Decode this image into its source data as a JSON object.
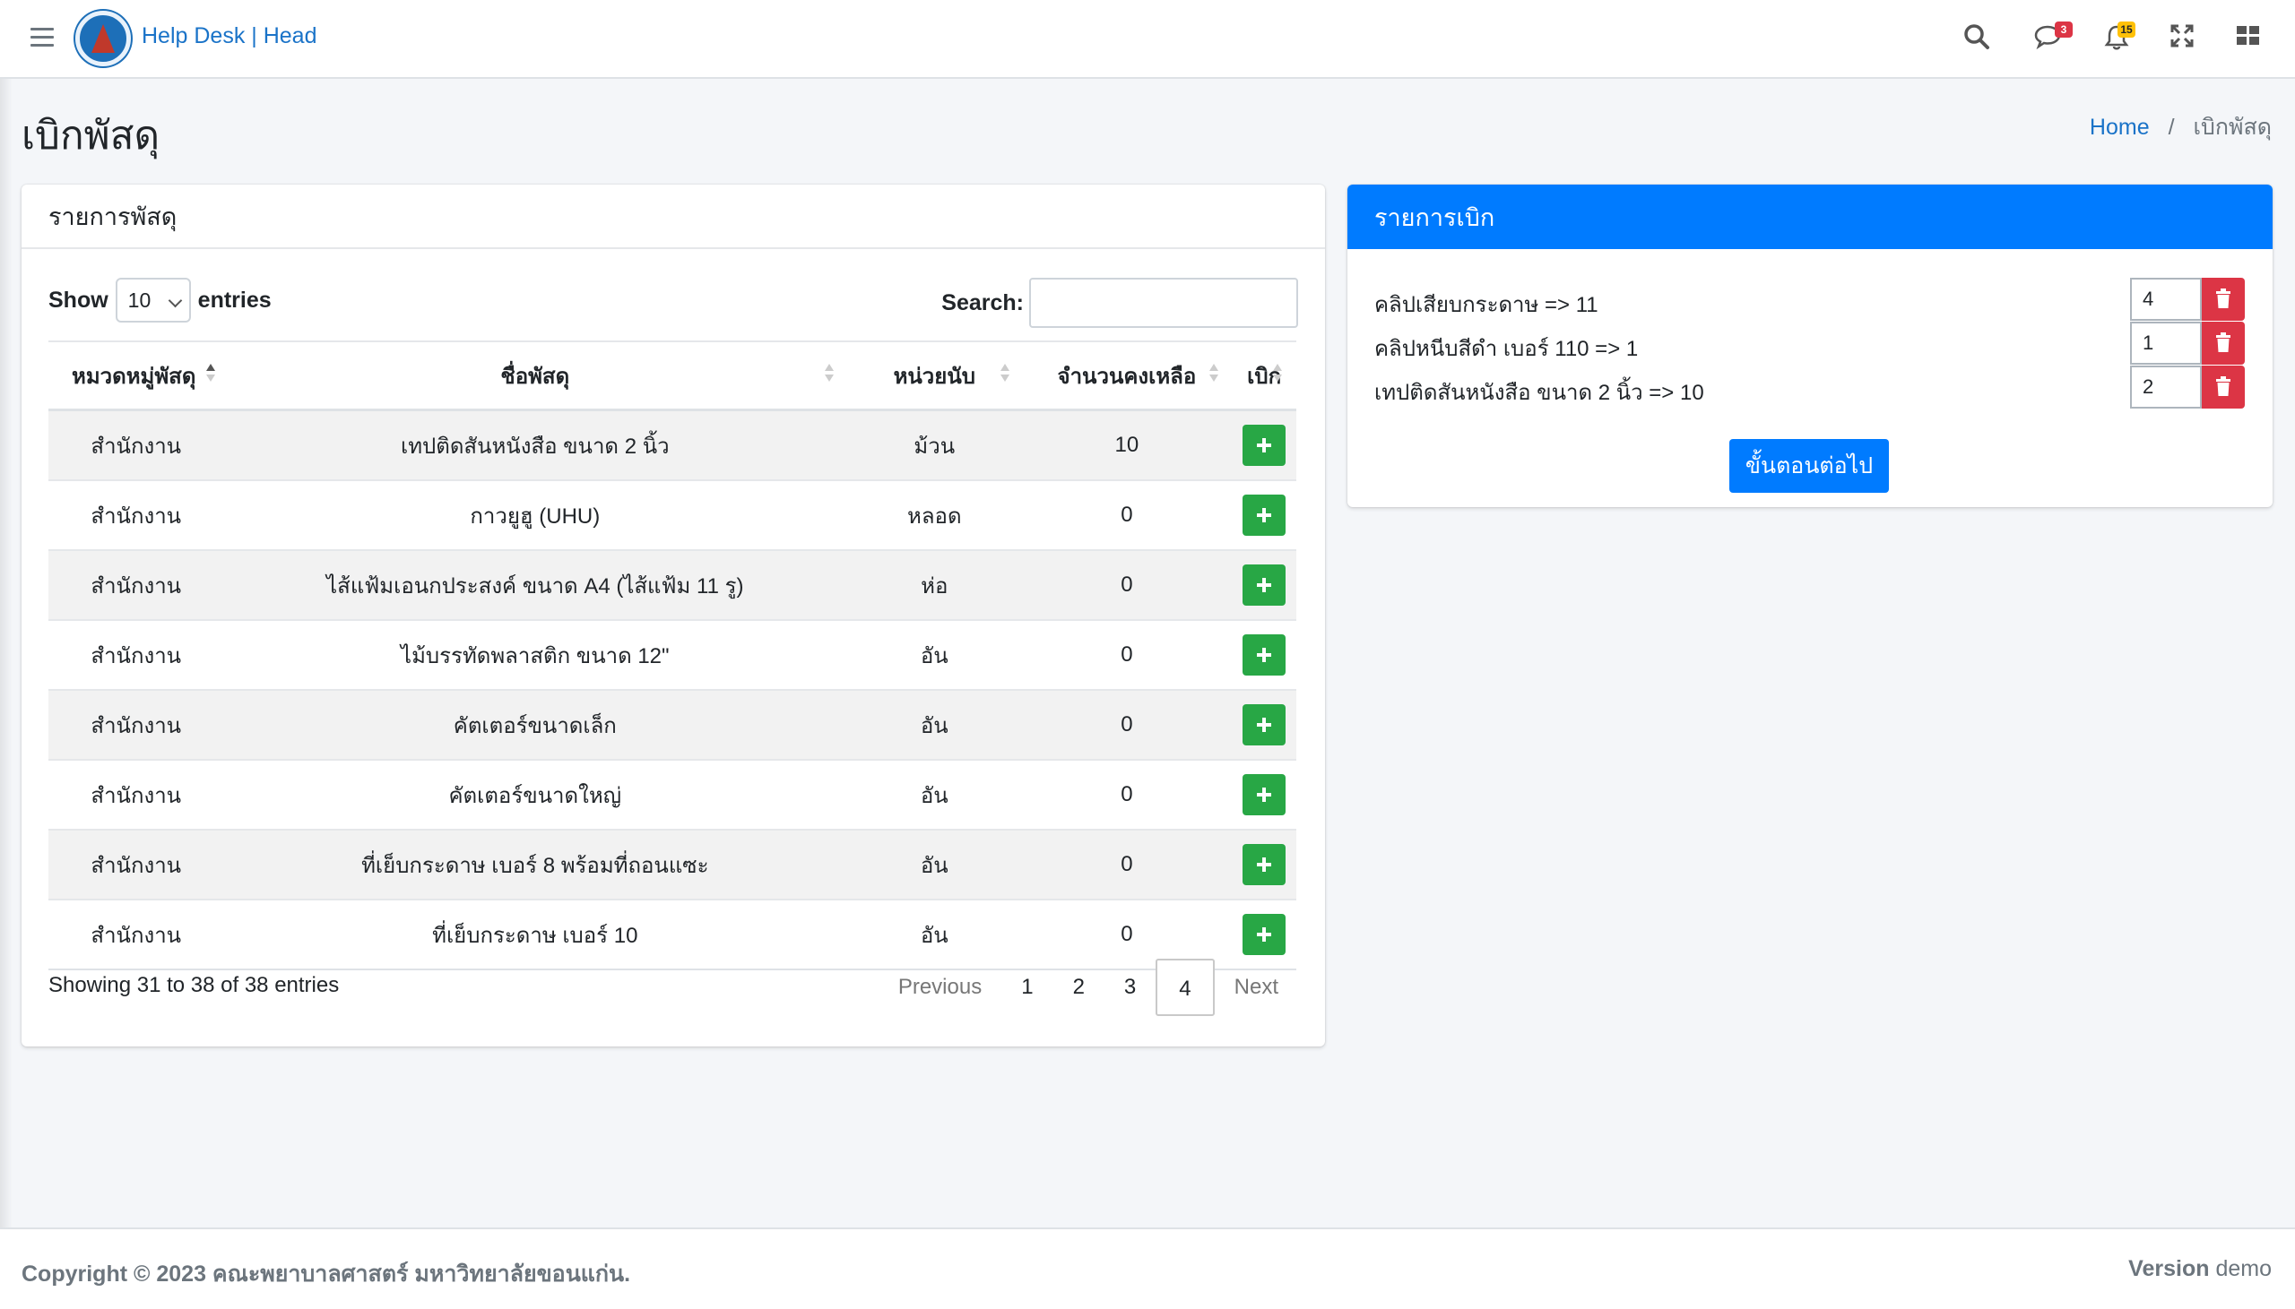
{
  "navbar": {
    "brand": "Help Desk | Head",
    "messages_badge": "3",
    "notifications_badge": "15",
    "icons": [
      "menu-icon",
      "search-icon",
      "comments-icon",
      "bell-icon",
      "expand-icon",
      "grid-icon"
    ]
  },
  "page": {
    "title": "เบิกพัสดุ",
    "breadcrumb": {
      "home": "Home",
      "current": "เบิกพัสดุ"
    }
  },
  "stock_card": {
    "title": "รายการพัสดุ",
    "show_label": "Show",
    "entries_label": "entries",
    "page_length": "10",
    "search_label": "Search:",
    "search_value": "",
    "columns": [
      "หมวดหมู่พัสดุ",
      "ชื่อพัสดุ",
      "หน่วยนับ",
      "จำนวนคงเหลือ",
      "เบิก"
    ],
    "rows": [
      {
        "category": "สำนักงาน",
        "name": "เทปติดสันหนังสือ ขนาด 2 นิ้ว",
        "unit": "ม้วน",
        "remaining": "10"
      },
      {
        "category": "สำนักงาน",
        "name": "กาวยูฮู (UHU)",
        "unit": "หลอด",
        "remaining": "0"
      },
      {
        "category": "สำนักงาน",
        "name": "ไส้แฟ้มเอนกประสงค์ ขนาด A4 (ไส้แฟ้ม 11 รู)",
        "unit": "ห่อ",
        "remaining": "0"
      },
      {
        "category": "สำนักงาน",
        "name": "ไม้บรรทัดพลาสติก ขนาด 12\"",
        "unit": "อัน",
        "remaining": "0"
      },
      {
        "category": "สำนักงาน",
        "name": "คัตเตอร์ขนาดเล็ก",
        "unit": "อัน",
        "remaining": "0"
      },
      {
        "category": "สำนักงาน",
        "name": "คัตเตอร์ขนาดใหญ่",
        "unit": "อัน",
        "remaining": "0"
      },
      {
        "category": "สำนักงาน",
        "name": "ที่เย็บกระดาษ เบอร์ 8 พร้อมที่ถอนแซะ",
        "unit": "อัน",
        "remaining": "0"
      },
      {
        "category": "สำนักงาน",
        "name": "ที่เย็บกระดาษ เบอร์ 10",
        "unit": "อัน",
        "remaining": "0"
      }
    ],
    "info": "Showing 31 to 38 of 38 entries",
    "pagination": {
      "previous": "Previous",
      "pages": [
        "1",
        "2",
        "3",
        "4"
      ],
      "current": "4",
      "next": "Next"
    }
  },
  "request_card": {
    "title": "รายการเบิก",
    "items": [
      {
        "label": "คลิปเสียบกระดาษ => 11",
        "qty": "4"
      },
      {
        "label": "คลิปหนีบสีดำ เบอร์ 110 => 1",
        "qty": "1"
      },
      {
        "label": "เทปติดสันหนังสือ ขนาด 2 นิ้ว => 10",
        "qty": "2"
      }
    ],
    "next_button": "ขั้นตอนต่อไป"
  },
  "footer": {
    "copyright": "Copyright © 2023 คณะพยาบาลศาสตร์ มหาวิทยาลัยขอนแก่น.",
    "version_label": "Version",
    "version_value": "demo"
  },
  "colors": {
    "primary": "#007bff",
    "success": "#28a745",
    "danger": "#dc3545",
    "brand_text": "#1a73c8"
  }
}
